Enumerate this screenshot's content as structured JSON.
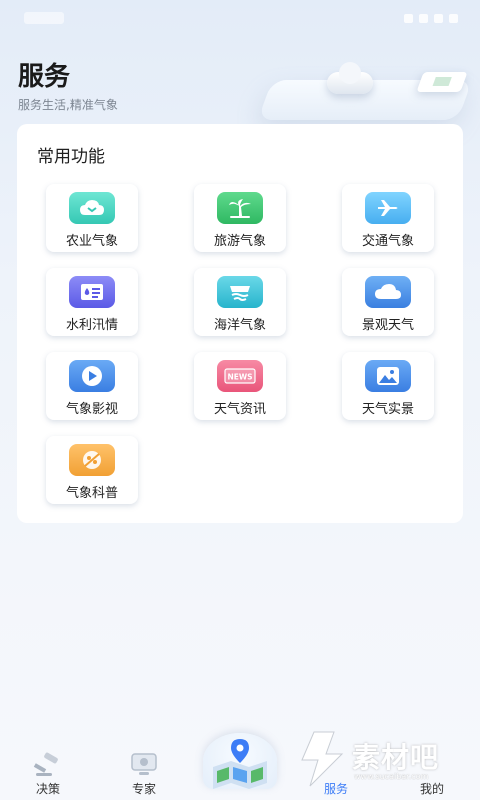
{
  "header": {
    "title": "服务",
    "subtitle": "服务生活,精准气象"
  },
  "functions": {
    "title": "常用功能",
    "items": [
      {
        "label": "农业气象",
        "icon": "agriculture-icon",
        "color": "#4fd8c6"
      },
      {
        "label": "旅游气象",
        "icon": "palm-tree-icon",
        "color": "#37c46e"
      },
      {
        "label": "交通气象",
        "icon": "airplane-icon",
        "color": "#4fb4f0"
      },
      {
        "label": "水利汛情",
        "icon": "water-conservancy-icon",
        "color": "#6f6ef0"
      },
      {
        "label": "海洋气象",
        "icon": "ocean-waves-icon",
        "color": "#33c2d6"
      },
      {
        "label": "景观天气",
        "icon": "cloud-icon",
        "color": "#4a90e8"
      },
      {
        "label": "气象影视",
        "icon": "video-play-icon",
        "color": "#4a8de8"
      },
      {
        "label": "天气资讯",
        "icon": "news-icon",
        "color": "#f06a8a"
      },
      {
        "label": "天气实景",
        "icon": "photo-icon",
        "color": "#4a8de8"
      },
      {
        "label": "气象科普",
        "icon": "science-icon",
        "color": "#f3a53b"
      }
    ]
  },
  "tabbar": {
    "tabs": [
      {
        "label": "决策",
        "icon": "gavel-icon",
        "active": false
      },
      {
        "label": "专家",
        "icon": "expert-monitor-icon",
        "active": false
      },
      {
        "label": "服务",
        "icon": "service-icon",
        "active": true
      },
      {
        "label": "我的",
        "icon": "profile-icon",
        "active": false
      }
    ],
    "center_icon": "map-location-icon",
    "active_color": "#3d7df6"
  },
  "watermark": {
    "text": "素材吧",
    "url": "www.sucaibar.com"
  }
}
